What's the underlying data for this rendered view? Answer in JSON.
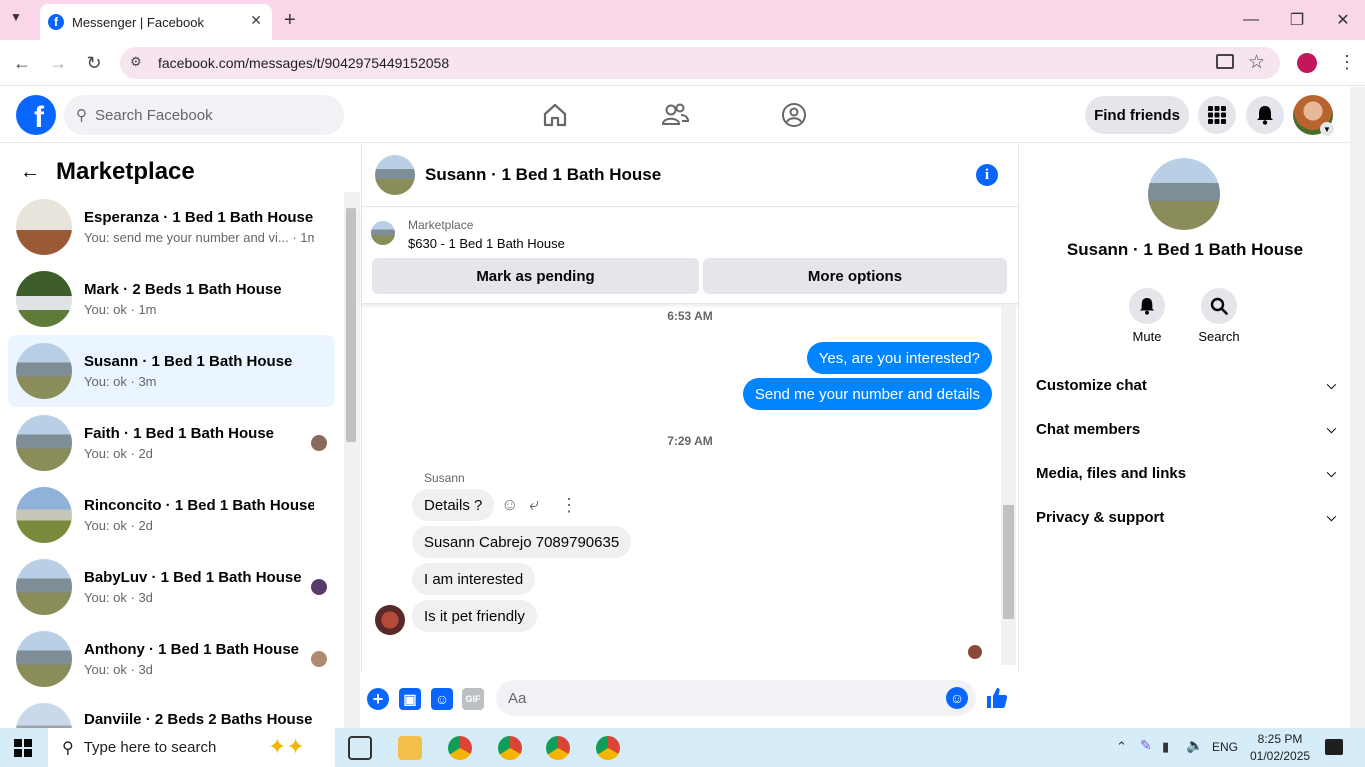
{
  "browser": {
    "tab_title": "Messenger | Facebook",
    "url": "facebook.com/messages/t/9042975449152058"
  },
  "header": {
    "search_placeholder": "Search Facebook",
    "find_friends": "Find friends"
  },
  "sidebar": {
    "title": "Marketplace",
    "conversations": [
      {
        "name": "Esperanza · 1 Bed 1 Bath House",
        "preview": "You: send me your number and vi... · 1m"
      },
      {
        "name": "Mark · 2 Beds 1 Bath House",
        "preview": "You: ok · 1m"
      },
      {
        "name": "Susann · 1 Bed 1 Bath House",
        "preview": "You: ok · 3m"
      },
      {
        "name": "Faith · 1 Bed 1 Bath House",
        "preview": "You: ok · 2d"
      },
      {
        "name": "Rinconcito · 1 Bed 1 Bath House",
        "preview": "You: ok · 2d"
      },
      {
        "name": "BabyLuv · 1 Bed 1 Bath House",
        "preview": "You: ok · 3d"
      },
      {
        "name": "Anthony · 1 Bed 1 Bath House",
        "preview": "You: ok · 3d"
      },
      {
        "name": "Danviile · 2 Beds 2 Baths House",
        "preview": ""
      }
    ]
  },
  "chat": {
    "title": "Susann · 1 Bed 1 Bath House",
    "listing_source": "Marketplace",
    "listing": "$630 - 1 Bed 1 Bath House",
    "mark_pending": "Mark as pending",
    "more_options": "More options",
    "time1": "6:53 AM",
    "out_msg1": "Yes, are you interested?",
    "out_msg2": "Send me your number and details",
    "time2": "7:29 AM",
    "sender": "Susann",
    "in_msg1": "Details ?",
    "in_msg2": "Susann Cabrejo 7089790635",
    "in_msg3": "I am interested",
    "in_msg4": "Is it pet friendly",
    "input_placeholder": "Aa"
  },
  "right": {
    "name": "Susann · 1 Bed 1 Bath House",
    "mute": "Mute",
    "search": "Search",
    "sections": [
      "Customize chat",
      "Chat members",
      "Media, files and links",
      "Privacy & support"
    ]
  },
  "taskbar": {
    "search_placeholder": "Type here to search",
    "lang": "ENG",
    "time": "8:25 PM",
    "date": "01/02/2025"
  },
  "colors": {
    "fb_blue": "#0866ff",
    "outgoing_bubble": "#0084ff",
    "tab_bar": "#f9d6e8"
  }
}
